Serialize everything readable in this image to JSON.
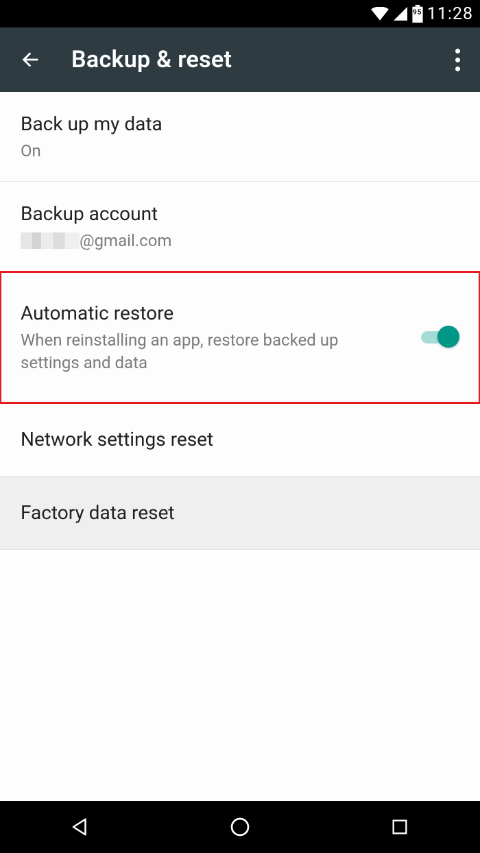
{
  "status_bar": {
    "time": "11:28",
    "battery_level": "95"
  },
  "app_bar": {
    "title": "Backup & reset"
  },
  "rows": {
    "backup_my_data": {
      "title": "Back up my data",
      "subtitle": "On"
    },
    "backup_account": {
      "title": "Backup account",
      "subtitle_suffix": "@gmail.com"
    },
    "automatic_restore": {
      "title": "Automatic restore",
      "subtitle": "When reinstalling an app, restore backed up settings and data",
      "toggle_on": true
    },
    "network_reset": {
      "title": "Network settings reset"
    },
    "factory_reset": {
      "title": "Factory data reset"
    }
  }
}
